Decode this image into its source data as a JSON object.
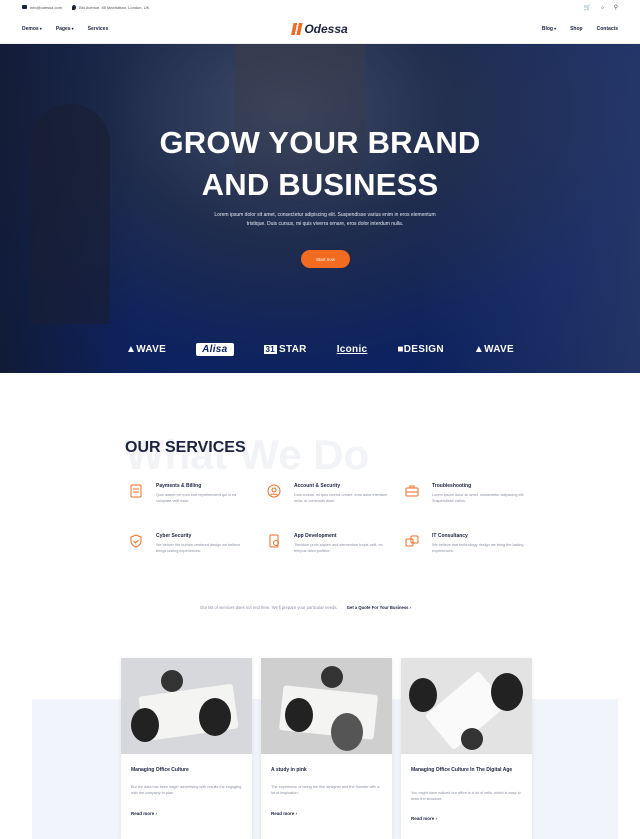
{
  "topbar": {
    "email": "info@odessa.com",
    "address": "Bld Avenue, 85 Manhattan, London, UK",
    "cart_count": "0"
  },
  "nav": {
    "left": [
      "Demos",
      "Pages",
      "Services"
    ],
    "brand": "Odessa",
    "right": [
      "Blog",
      "Shop",
      "Contacts"
    ]
  },
  "hero": {
    "title_line1": "GROW YOUR BRAND",
    "title_line2": "AND BUSINESS",
    "text": "Lorem ipsum dolor sit amet, consectetur adipiscing elit. Suspendisse varius enim in eros elementum tristique. Duis cursus, mi quis viverra ornare, eros dolor interdum nulla.",
    "button": "Start now",
    "logos": [
      "WAVE",
      "Alisa",
      "STAR",
      "Iconic",
      "DESIGN",
      "WAVE"
    ],
    "logo_star_badge": "31"
  },
  "services": {
    "ghost": "What We Do",
    "heading": "OUR SERVICES",
    "items": [
      {
        "title": "Payments & Billing",
        "desc": "Quis autem vel eum iure reprehenderit qui in ea voluptate velit esse.",
        "icon": "billing-icon"
      },
      {
        "title": "Account & Security",
        "desc": "Duis cursus, mi quis viverra ornare, eros dolor interdum nulla, ut commodo diam.",
        "icon": "account-security-icon"
      },
      {
        "title": "Troubleshooting",
        "desc": "Lorem ipsum dolor sit amet, consectetur adipiscing elit. Suspendisse varius.",
        "icon": "toolbox-icon"
      },
      {
        "title": "Cyber Security",
        "desc": "We deliver the human-centered design we believe brings lasting experiences.",
        "icon": "shield-icon"
      },
      {
        "title": "App Development",
        "desc": "Tincidunt proin sapien and elementum turpis velit, mi tempus diam porttitor.",
        "icon": "app-development-icon"
      },
      {
        "title": "IT Consultancy",
        "desc": "We believe that technology design we bring the lasting experiences.",
        "icon": "consultancy-icon"
      }
    ],
    "quote_text": "Our list of services does not end here. We'll prepare your particular needs.",
    "quote_link": "Get a Quote For Your Business"
  },
  "blog": [
    {
      "title": "Managing Office Culture",
      "desc": "But the data has been eager advertising with results the engaging with the company to plan.",
      "link": "Read more"
    },
    {
      "title": "A study in pink",
      "desc": "The experience of being the first designer and the founder with a lot of inspiration.",
      "link": "Read more"
    },
    {
      "title": "Managing Office Culture In The Digital Age",
      "desc": "You might have noticed our office is a lot of cells, which is easy to draw the structure.",
      "link": "Read more"
    }
  ],
  "colors": {
    "accent": "#f26b21",
    "navy": "#0d2260",
    "text": "#1c2340"
  }
}
